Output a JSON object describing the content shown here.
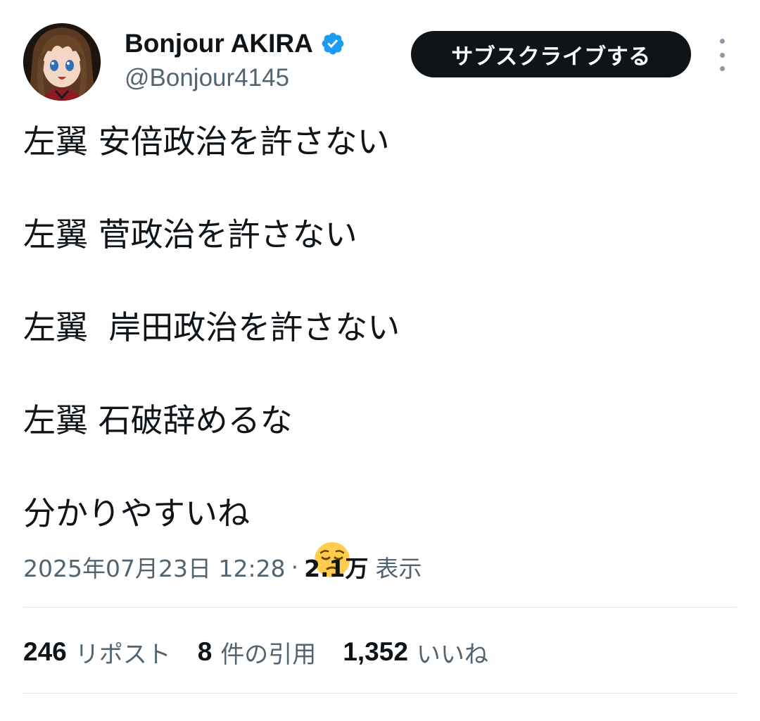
{
  "author": {
    "display_name": "Bonjour AKIRA",
    "handle": "@Bonjour4145",
    "verified": true,
    "avatar": "avatar-anime-character"
  },
  "actions": {
    "subscribe_label": "サブスクライブする",
    "more_icon": "more-vertical-icon"
  },
  "tweet": {
    "lines": [
      "左翼 安倍政治を許さない",
      "左翼 菅政治を許さない",
      "左翼  岸田政治を許さない",
      "左翼 石破辞めるな",
      "分かりやすいね"
    ],
    "emoji": "pensive-face-emoji"
  },
  "meta": {
    "timestamp": "2025年07月23日 12:28",
    "separator": "·",
    "views_count": "2.1万",
    "views_label": "表示"
  },
  "stats": {
    "reposts_count": "246",
    "reposts_label": "リポスト",
    "quotes_count": "8",
    "quotes_label": "件の引用",
    "likes_count": "1,352",
    "likes_label": "いいね"
  },
  "colors": {
    "text_primary": "#0f1419",
    "text_secondary": "#536471",
    "verified_blue": "#1d9bf0",
    "button_bg": "#0f1419",
    "divider": "#e1e8ed"
  }
}
